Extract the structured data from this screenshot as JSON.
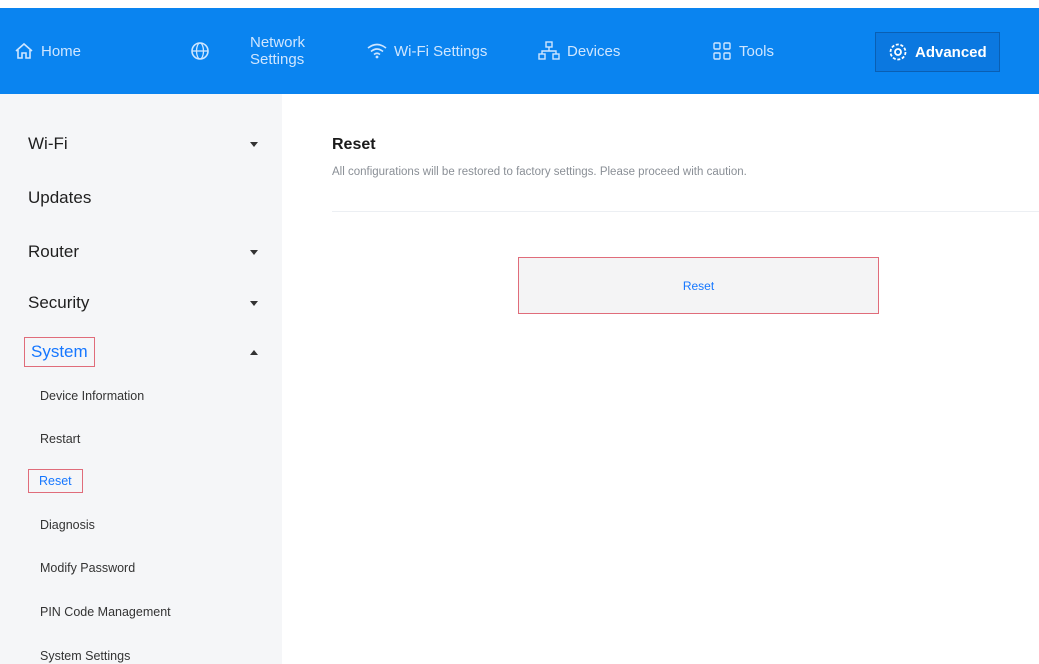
{
  "nav": {
    "home": "Home",
    "network_settings_line1": "Network",
    "network_settings_line2": "Settings",
    "wifi_settings": "Wi-Fi Settings",
    "devices": "Devices",
    "tools": "Tools",
    "advanced": "Advanced"
  },
  "sidebar": {
    "groups": [
      {
        "label": "Wi-Fi",
        "caret": "down"
      },
      {
        "label": "Updates"
      },
      {
        "label": "Router",
        "caret": "down"
      },
      {
        "label": "Security",
        "caret": "down"
      },
      {
        "label": "System",
        "caret": "up"
      }
    ],
    "system_items": [
      "Device Information",
      "Restart",
      "Reset",
      "Diagnosis",
      "Modify Password",
      "PIN Code Management",
      "System Settings"
    ]
  },
  "main": {
    "title": "Reset",
    "description": "All configurations will be restored to factory settings. Please proceed with caution.",
    "reset_button": "Reset"
  },
  "colors": {
    "nav_bg": "#0a84f0",
    "accent": "#1677ff",
    "highlight_border": "#e06c7a",
    "sidebar_bg": "#f5f6f8"
  }
}
